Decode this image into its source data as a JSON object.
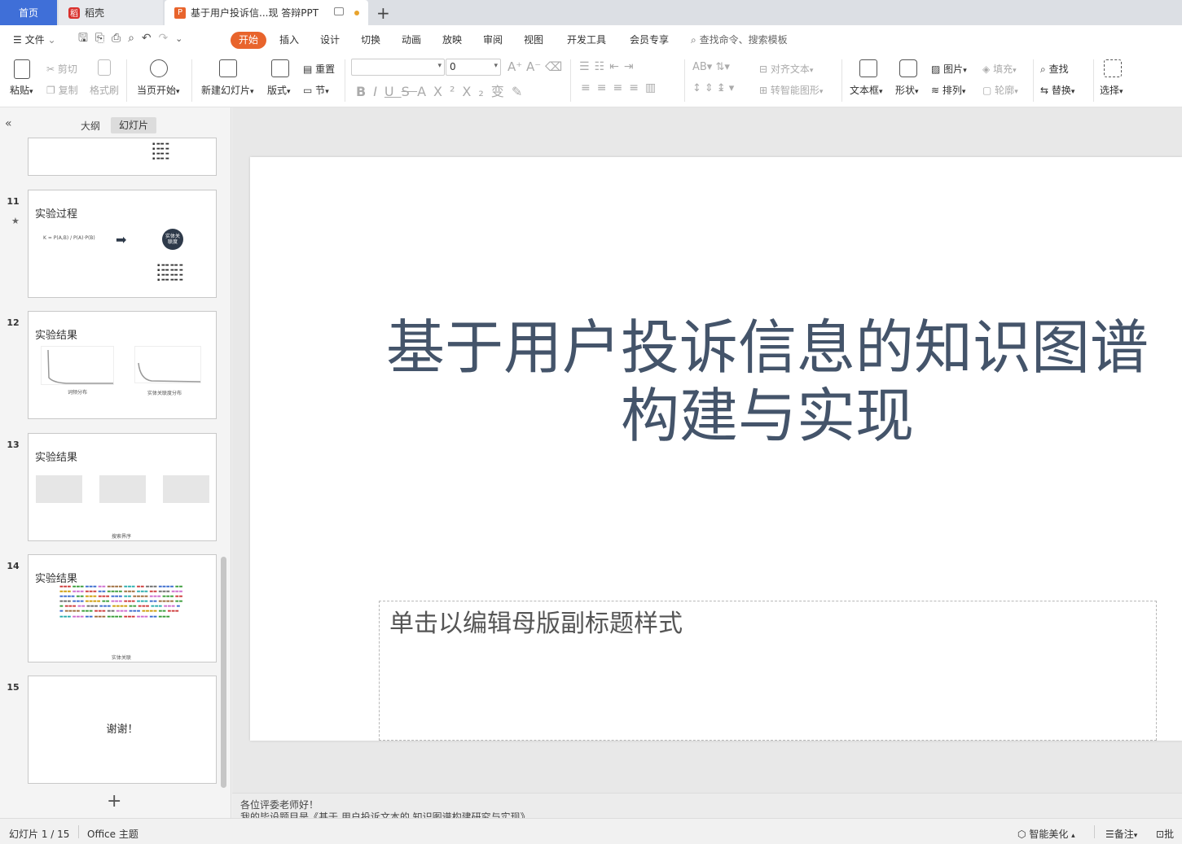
{
  "tabs": {
    "home": "首页",
    "daoke": "稻壳",
    "doc_title": "基于用户投诉信...现 答辩PPT",
    "new_tab": "+"
  },
  "menu": {
    "file": "文件",
    "items": [
      "开始",
      "插入",
      "设计",
      "切换",
      "动画",
      "放映",
      "审阅",
      "视图",
      "开发工具",
      "会员专享"
    ],
    "search": "查找命令、搜索模板"
  },
  "ribbon": {
    "paste": "粘贴",
    "cut": "剪切",
    "copy": "复制",
    "format_painter": "格式刷",
    "from_current": "当页开始",
    "new_slide": "新建幻灯片",
    "layout": "版式",
    "reset": "重置",
    "section": "节",
    "font_size": "0",
    "align_text": "对齐文本",
    "smartart": "转智能图形",
    "textbox": "文本框",
    "shape": "形状",
    "picture": "图片",
    "arrange": "排列",
    "fill": "填充",
    "outline": "轮廓",
    "find": "查找",
    "replace": "替换",
    "select": "选择"
  },
  "panel": {
    "outline_tab": "大纲",
    "slides_tab": "幻灯片",
    "add": "+"
  },
  "thumbnails": [
    {
      "num": "11",
      "title": "实验过程",
      "circle": "实体关联度",
      "formula": "K = P(A,B) / P(A)·P(B)"
    },
    {
      "num": "12",
      "title": "实验结果",
      "cap1": "词频分布",
      "cap2": "实体关联度分布"
    },
    {
      "num": "13",
      "title": "实验结果",
      "cap": "搜索界序"
    },
    {
      "num": "14",
      "title": "实验结果",
      "cap": "实体关联"
    },
    {
      "num": "15",
      "title": "",
      "center": "谢谢！"
    }
  ],
  "slide": {
    "title_line1": "基于用户投诉信息的知识图谱",
    "title_line2": "构建与实现",
    "subtitle_placeholder": "单击以编辑母版副标题样式"
  },
  "notes": {
    "line1": "各位评委老师好！",
    "line2": "我的毕设题目是《基于 用户投诉文本的 知识图谱构建研究与实现》"
  },
  "status": {
    "slide_counter": "幻灯片 1 / 15",
    "theme": "Office 主题",
    "beautify": "智能美化",
    "notes": "备注",
    "comment": "批"
  },
  "colors": {
    "accent": "#e8642c",
    "home_tab": "#3f6fd8",
    "title_text": "#44546a"
  }
}
